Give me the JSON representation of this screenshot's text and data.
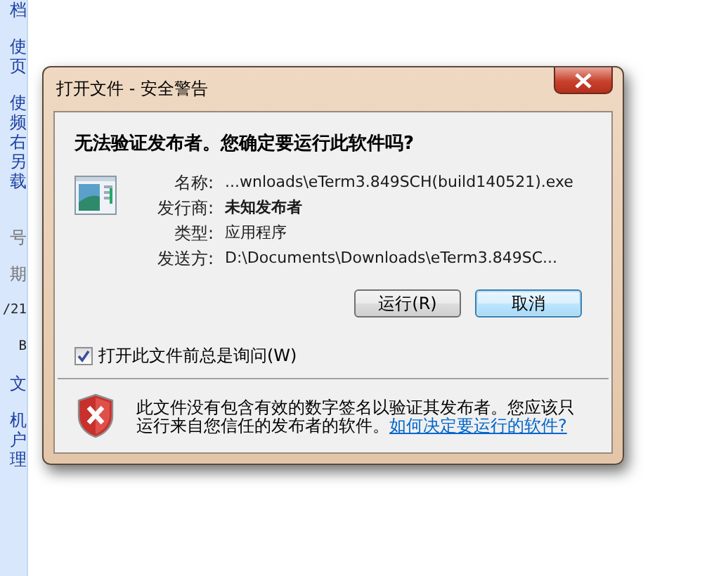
{
  "background_page": {
    "sidebar_groups": [
      {
        "kind": "link",
        "lines": [
          "档"
        ]
      },
      {
        "kind": "link",
        "lines": [
          "使",
          "页"
        ]
      },
      {
        "kind": "link",
        "lines": [
          "使",
          "频",
          "右",
          "另",
          "载"
        ]
      },
      {
        "kind": "muted",
        "lines": [
          "号"
        ]
      },
      {
        "kind": "muted",
        "lines": [
          "期"
        ]
      },
      {
        "kind": "text",
        "lines": [
          "/21"
        ]
      },
      {
        "kind": "text",
        "lines": [
          "B"
        ]
      },
      {
        "kind": "link",
        "lines": [
          "文"
        ]
      },
      {
        "kind": "link",
        "lines": [
          "机",
          "户",
          "理"
        ]
      }
    ]
  },
  "dialog": {
    "title": "打开文件 - 安全警告",
    "heading": "无法验证发布者。您确定要运行此软件吗?",
    "fields": [
      {
        "label": "名称:",
        "value": "...wnloads\\eTerm3.849SCH(build140521).exe",
        "kind": "plain"
      },
      {
        "label": "发行商:",
        "value": "未知发布者",
        "kind": "bold"
      },
      {
        "label": "类型:",
        "value": "应用程序",
        "kind": "plain"
      },
      {
        "label": "发送方:",
        "value": "D:\\Documents\\Downloads\\eTerm3.849SC...",
        "kind": "plain"
      }
    ],
    "buttons": [
      {
        "label": "运行(R)",
        "default": false
      },
      {
        "label": "取消",
        "default": true
      }
    ],
    "checkbox": {
      "label": "打开此文件前总是询问(W)",
      "checked": true
    },
    "warning": {
      "text": "此文件没有包含有效的数字签名以验证其发布者。您应该只运行来自您信任的发布者的软件。",
      "link": "如何决定要运行的软件?"
    }
  }
}
